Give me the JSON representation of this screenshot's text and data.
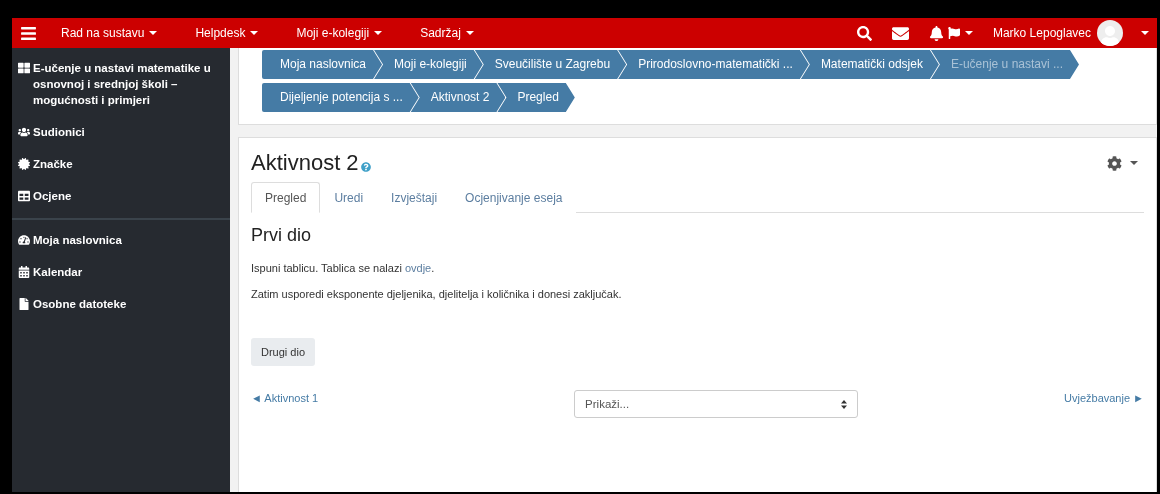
{
  "navbar": {
    "menus": [
      "Rad na sustavu",
      "Helpdesk",
      "Moji e-kolegiji",
      "Sadržaj"
    ],
    "user_name": "Marko Lepoglavec"
  },
  "sidebar": {
    "sections": [
      {
        "items": [
          {
            "kind": "course",
            "label": "E-učenje u nastavi matematike u osnovnoj i srednjoj školi – mogućnosti i primjeri"
          },
          {
            "kind": "users",
            "label": "Sudionici"
          },
          {
            "kind": "badge",
            "label": "Značke"
          },
          {
            "kind": "grades",
            "label": "Ocjene"
          }
        ]
      },
      {
        "items": [
          {
            "kind": "dashboard",
            "label": "Moja naslovnica"
          },
          {
            "kind": "calendar",
            "label": "Kalendar"
          },
          {
            "kind": "file",
            "label": "Osobne datoteke"
          }
        ]
      }
    ]
  },
  "breadcrumb_rows": [
    [
      {
        "label": "Moja naslovnica",
        "muted": false
      },
      {
        "label": "Moji e-kolegiji",
        "muted": false
      },
      {
        "label": "Sveučilište u Zagrebu",
        "muted": false
      },
      {
        "label": "Prirodoslovno-matematički ...",
        "muted": false
      },
      {
        "label": "Matematički odsjek",
        "muted": false
      },
      {
        "label": "E-učenje u nastavi ...",
        "muted": true
      }
    ],
    [
      {
        "label": "Dijeljenje potencija s ...",
        "muted": false
      },
      {
        "label": "Aktivnost 2",
        "muted": false
      },
      {
        "label": "Pregled",
        "muted": false
      }
    ]
  ],
  "page": {
    "title": "Aktivnost 2",
    "tabs": [
      {
        "label": "Pregled",
        "selected": true
      },
      {
        "label": "Uredi",
        "selected": false
      },
      {
        "label": "Izvještaji",
        "selected": false
      },
      {
        "label": "Ocjenjivanje eseja",
        "selected": false
      }
    ],
    "heading": "Prvi dio",
    "paragraph_1": {
      "text": "Ispuni tablicu. Tablica se nalazi ",
      "link": "ovdje",
      "end": "."
    },
    "paragraph_2": "Zatim usporedi eksponente djeljenika, djelitelja i količnika i donesi zaključak.",
    "button": "Drugi dio",
    "prev_link": "◄ Aktivnost 1",
    "jump_select": {
      "placeholder": "Prikaži..."
    },
    "next_link": "Uvježbavanje ►"
  }
}
